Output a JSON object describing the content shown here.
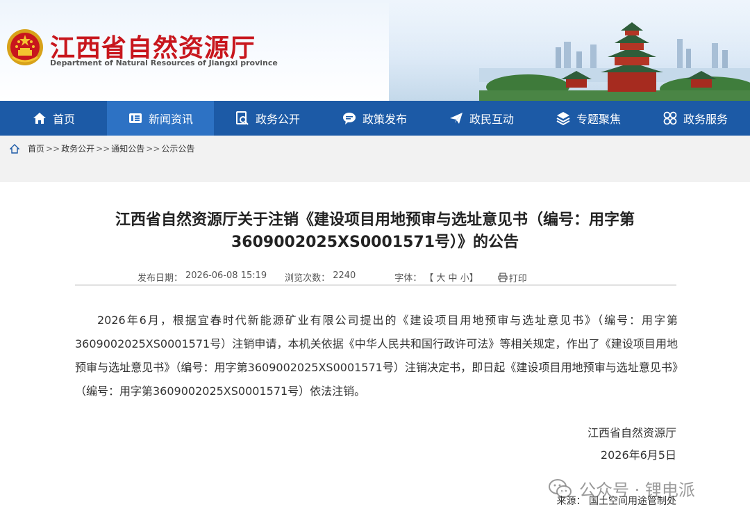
{
  "header": {
    "site_title": "江西省自然资源厅",
    "site_subtitle": "Department of Natural Resources of Jiangxi province",
    "emblem_icon": "national-emblem-icon",
    "brand_color": "#c8161d"
  },
  "nav": {
    "color": "#1c5aa6",
    "items": [
      {
        "label": "首页",
        "icon": "home-icon"
      },
      {
        "label": "新闻资讯",
        "icon": "news-icon",
        "active": true
      },
      {
        "label": "政务公开",
        "icon": "doc-search-icon"
      },
      {
        "label": "政策发布",
        "icon": "chat-bubble-icon"
      },
      {
        "label": "政民互动",
        "icon": "paper-plane-icon"
      },
      {
        "label": "专题聚焦",
        "icon": "layers-icon"
      },
      {
        "label": "政务服务",
        "icon": "grid-circles-icon"
      }
    ]
  },
  "breadcrumb": {
    "items": [
      "首页",
      "政务公开",
      "通知公告",
      "公示公告"
    ],
    "separator": ">>"
  },
  "article": {
    "title_line1": "江西省自然资源厅关于注销《建设项目用地预审与选址意见书（编号：用字第",
    "title_line2": "3609002025XS0001571号）》的公告",
    "meta": {
      "date_label": "发布日期：",
      "date_value": "2026-06-08 15:19",
      "views_label": "浏览次数：",
      "views_value": "2240",
      "font_label": "字体：",
      "font_options": "【 大 中 小】",
      "print_label": "打印"
    },
    "body": "2026年6月，根据宜春时代新能源矿业有限公司提出的《建设项目用地预审与选址意见书》（编号：用字第3609002025XS0001571号）注销申请，本机关依据《中华人民共和国行政许可法》等相关规定，作出了《建设项目用地预审与选址意见书》（编号：用字第3609002025XS0001571号）注销决定书，即日起《建设项目用地预审与选址意见书》（编号：用字第3609002025XS0001571号）依法注销。",
    "sign_org": "江西省自然资源厅",
    "sign_date": "2026年6月5日",
    "source": "来源：  国土空间用途管制处"
  },
  "watermark": {
    "text": "公众号 · 锂电派",
    "icon": "wechat-icon"
  }
}
